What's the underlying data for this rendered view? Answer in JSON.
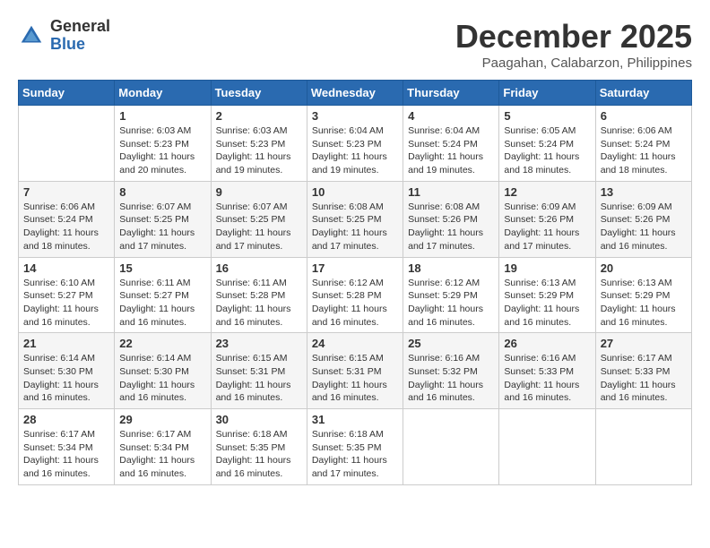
{
  "header": {
    "logo_general": "General",
    "logo_blue": "Blue",
    "month_title": "December 2025",
    "location": "Paagahan, Calabarzon, Philippines"
  },
  "weekdays": [
    "Sunday",
    "Monday",
    "Tuesday",
    "Wednesday",
    "Thursday",
    "Friday",
    "Saturday"
  ],
  "weeks": [
    [
      {
        "day": "",
        "sunrise": "",
        "sunset": "",
        "daylight": ""
      },
      {
        "day": "1",
        "sunrise": "Sunrise: 6:03 AM",
        "sunset": "Sunset: 5:23 PM",
        "daylight": "Daylight: 11 hours and 20 minutes."
      },
      {
        "day": "2",
        "sunrise": "Sunrise: 6:03 AM",
        "sunset": "Sunset: 5:23 PM",
        "daylight": "Daylight: 11 hours and 19 minutes."
      },
      {
        "day": "3",
        "sunrise": "Sunrise: 6:04 AM",
        "sunset": "Sunset: 5:23 PM",
        "daylight": "Daylight: 11 hours and 19 minutes."
      },
      {
        "day": "4",
        "sunrise": "Sunrise: 6:04 AM",
        "sunset": "Sunset: 5:24 PM",
        "daylight": "Daylight: 11 hours and 19 minutes."
      },
      {
        "day": "5",
        "sunrise": "Sunrise: 6:05 AM",
        "sunset": "Sunset: 5:24 PM",
        "daylight": "Daylight: 11 hours and 18 minutes."
      },
      {
        "day": "6",
        "sunrise": "Sunrise: 6:06 AM",
        "sunset": "Sunset: 5:24 PM",
        "daylight": "Daylight: 11 hours and 18 minutes."
      }
    ],
    [
      {
        "day": "7",
        "sunrise": "Sunrise: 6:06 AM",
        "sunset": "Sunset: 5:24 PM",
        "daylight": "Daylight: 11 hours and 18 minutes."
      },
      {
        "day": "8",
        "sunrise": "Sunrise: 6:07 AM",
        "sunset": "Sunset: 5:25 PM",
        "daylight": "Daylight: 11 hours and 17 minutes."
      },
      {
        "day": "9",
        "sunrise": "Sunrise: 6:07 AM",
        "sunset": "Sunset: 5:25 PM",
        "daylight": "Daylight: 11 hours and 17 minutes."
      },
      {
        "day": "10",
        "sunrise": "Sunrise: 6:08 AM",
        "sunset": "Sunset: 5:25 PM",
        "daylight": "Daylight: 11 hours and 17 minutes."
      },
      {
        "day": "11",
        "sunrise": "Sunrise: 6:08 AM",
        "sunset": "Sunset: 5:26 PM",
        "daylight": "Daylight: 11 hours and 17 minutes."
      },
      {
        "day": "12",
        "sunrise": "Sunrise: 6:09 AM",
        "sunset": "Sunset: 5:26 PM",
        "daylight": "Daylight: 11 hours and 17 minutes."
      },
      {
        "day": "13",
        "sunrise": "Sunrise: 6:09 AM",
        "sunset": "Sunset: 5:26 PM",
        "daylight": "Daylight: 11 hours and 16 minutes."
      }
    ],
    [
      {
        "day": "14",
        "sunrise": "Sunrise: 6:10 AM",
        "sunset": "Sunset: 5:27 PM",
        "daylight": "Daylight: 11 hours and 16 minutes."
      },
      {
        "day": "15",
        "sunrise": "Sunrise: 6:11 AM",
        "sunset": "Sunset: 5:27 PM",
        "daylight": "Daylight: 11 hours and 16 minutes."
      },
      {
        "day": "16",
        "sunrise": "Sunrise: 6:11 AM",
        "sunset": "Sunset: 5:28 PM",
        "daylight": "Daylight: 11 hours and 16 minutes."
      },
      {
        "day": "17",
        "sunrise": "Sunrise: 6:12 AM",
        "sunset": "Sunset: 5:28 PM",
        "daylight": "Daylight: 11 hours and 16 minutes."
      },
      {
        "day": "18",
        "sunrise": "Sunrise: 6:12 AM",
        "sunset": "Sunset: 5:29 PM",
        "daylight": "Daylight: 11 hours and 16 minutes."
      },
      {
        "day": "19",
        "sunrise": "Sunrise: 6:13 AM",
        "sunset": "Sunset: 5:29 PM",
        "daylight": "Daylight: 11 hours and 16 minutes."
      },
      {
        "day": "20",
        "sunrise": "Sunrise: 6:13 AM",
        "sunset": "Sunset: 5:29 PM",
        "daylight": "Daylight: 11 hours and 16 minutes."
      }
    ],
    [
      {
        "day": "21",
        "sunrise": "Sunrise: 6:14 AM",
        "sunset": "Sunset: 5:30 PM",
        "daylight": "Daylight: 11 hours and 16 minutes."
      },
      {
        "day": "22",
        "sunrise": "Sunrise: 6:14 AM",
        "sunset": "Sunset: 5:30 PM",
        "daylight": "Daylight: 11 hours and 16 minutes."
      },
      {
        "day": "23",
        "sunrise": "Sunrise: 6:15 AM",
        "sunset": "Sunset: 5:31 PM",
        "daylight": "Daylight: 11 hours and 16 minutes."
      },
      {
        "day": "24",
        "sunrise": "Sunrise: 6:15 AM",
        "sunset": "Sunset: 5:31 PM",
        "daylight": "Daylight: 11 hours and 16 minutes."
      },
      {
        "day": "25",
        "sunrise": "Sunrise: 6:16 AM",
        "sunset": "Sunset: 5:32 PM",
        "daylight": "Daylight: 11 hours and 16 minutes."
      },
      {
        "day": "26",
        "sunrise": "Sunrise: 6:16 AM",
        "sunset": "Sunset: 5:33 PM",
        "daylight": "Daylight: 11 hours and 16 minutes."
      },
      {
        "day": "27",
        "sunrise": "Sunrise: 6:17 AM",
        "sunset": "Sunset: 5:33 PM",
        "daylight": "Daylight: 11 hours and 16 minutes."
      }
    ],
    [
      {
        "day": "28",
        "sunrise": "Sunrise: 6:17 AM",
        "sunset": "Sunset: 5:34 PM",
        "daylight": "Daylight: 11 hours and 16 minutes."
      },
      {
        "day": "29",
        "sunrise": "Sunrise: 6:17 AM",
        "sunset": "Sunset: 5:34 PM",
        "daylight": "Daylight: 11 hours and 16 minutes."
      },
      {
        "day": "30",
        "sunrise": "Sunrise: 6:18 AM",
        "sunset": "Sunset: 5:35 PM",
        "daylight": "Daylight: 11 hours and 16 minutes."
      },
      {
        "day": "31",
        "sunrise": "Sunrise: 6:18 AM",
        "sunset": "Sunset: 5:35 PM",
        "daylight": "Daylight: 11 hours and 17 minutes."
      },
      {
        "day": "",
        "sunrise": "",
        "sunset": "",
        "daylight": ""
      },
      {
        "day": "",
        "sunrise": "",
        "sunset": "",
        "daylight": ""
      },
      {
        "day": "",
        "sunrise": "",
        "sunset": "",
        "daylight": ""
      }
    ]
  ]
}
